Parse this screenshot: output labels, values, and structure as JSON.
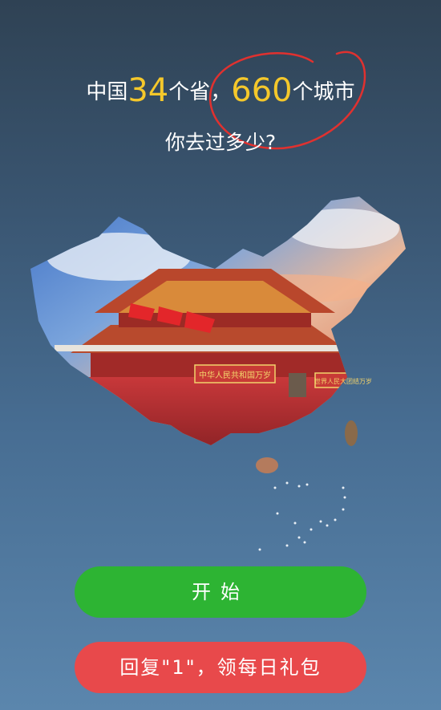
{
  "headline": {
    "part1": "中国",
    "num1": "34",
    "part2": "个省，",
    "num2": "660",
    "part3": "个城市"
  },
  "subline": "你去过多少?",
  "map_image": {
    "description_icon": "china-map-tiananmen-icon",
    "banner_left": "中华人民共和国万岁",
    "banner_right": "世界人民大团结万岁"
  },
  "buttons": {
    "start_label": "开始",
    "gift_label": "回复\"1\"，领每日礼包"
  },
  "colors": {
    "accent_number": "#f5c82b",
    "start_button": "#2db433",
    "gift_button": "#e8494b",
    "circle_mark": "#e0312f"
  }
}
